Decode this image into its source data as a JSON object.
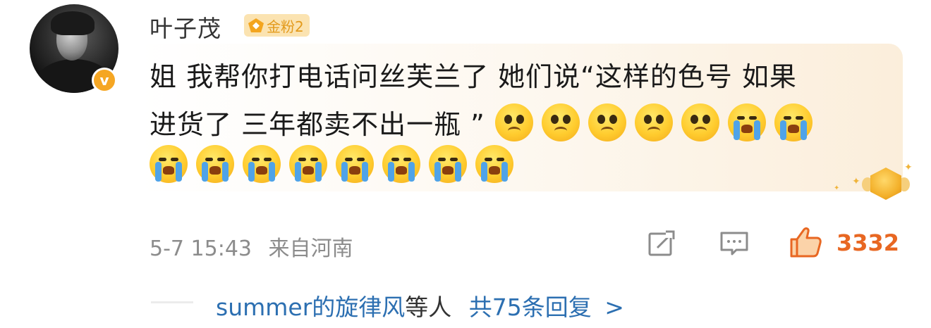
{
  "comment": {
    "username": "叶子茂",
    "fan_badge": "金粉2",
    "verified_badge": "v",
    "text_line1": "姐 我帮你打电话问丝芙兰了 她们说“这样的色号 如果",
    "text_line2": "进货了 三年都卖不出一瓶 ”",
    "emojis_line2": [
      "sad-face-emoji",
      "sad-face-emoji",
      "sad-face-emoji",
      "sad-face-emoji",
      "sad-face-emoji",
      "crying-face-emoji",
      "crying-face-emoji"
    ],
    "emojis_line3": [
      "crying-face-emoji",
      "crying-face-emoji",
      "crying-face-emoji",
      "crying-face-emoji",
      "crying-face-emoji",
      "crying-face-emoji",
      "crying-face-emoji",
      "crying-face-emoji"
    ],
    "timestamp": "5-7 15:43",
    "location": "来自河南",
    "like_count": "3332"
  },
  "replies": {
    "user": "summer的旋律风",
    "suffix": "等人",
    "count_label": "共75条回复",
    "arrow": ">"
  },
  "icons": {
    "share": "share-icon",
    "comment": "comment-icon",
    "like": "thumbs-up-icon"
  },
  "colors": {
    "accent_orange": "#e86722",
    "link_blue": "#2c6fb1",
    "badge_gold": "#f5a623"
  }
}
